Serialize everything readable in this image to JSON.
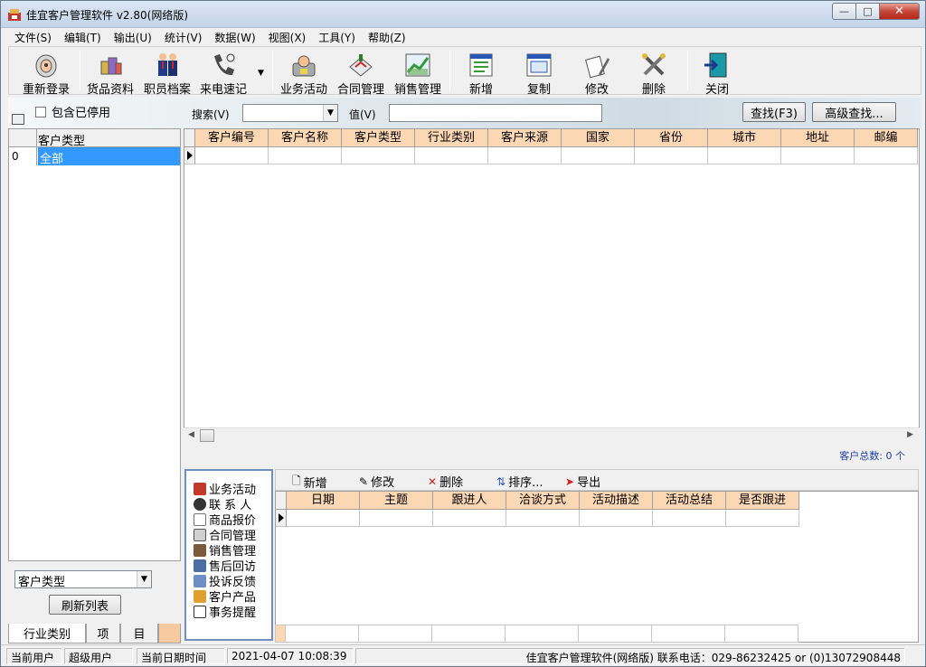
{
  "window": {
    "title": "佳宜客户管理软件 v2.80(网络版)"
  },
  "menu": [
    "文件(S)",
    "编辑(T)",
    "输出(U)",
    "统计(V)",
    "数据(W)",
    "视图(X)",
    "工具(Y)",
    "帮助(Z)"
  ],
  "toolbar": {
    "relogin": "重新登录",
    "goods": "货品资料",
    "staff": "职员档案",
    "calls": "来电速记",
    "activity": "业务活动",
    "contracts": "合同管理",
    "sales": "销售管理",
    "add": "新增",
    "copy": "复制",
    "edit": "修改",
    "delete": "删除",
    "close": "关闭"
  },
  "search": {
    "include_disabled": "包含已停用",
    "search_label": "搜索(V)",
    "value_label": "值(V)",
    "find_button": "查找(F3)",
    "advanced_button": "高级查找..."
  },
  "left": {
    "header": "客户类型",
    "rows": [
      {
        "index": "0",
        "label": "全部"
      }
    ],
    "filter_value": "客户类型",
    "refresh": "刷新列表",
    "tabs": [
      "行业类别",
      "项",
      "目"
    ]
  },
  "grid": {
    "columns": [
      "客户编号",
      "客户名称",
      "客户类型",
      "行业类别",
      "客户来源",
      "国家",
      "省份",
      "城市",
      "地址",
      "邮编"
    ]
  },
  "total_label": "客户总数: 0 个",
  "nav": [
    "业务活动",
    "联 系 人",
    "商品报价",
    "合同管理",
    "销售管理",
    "售后回访",
    "投诉反馈",
    "客户产品",
    "事务提醒"
  ],
  "subtoolbar": {
    "add": "新增",
    "edit": "修改",
    "delete": "删除",
    "sort": "排序...",
    "export": "导出"
  },
  "subgrid": {
    "columns": [
      "日期",
      "主题",
      "跟进人",
      "洽谈方式",
      "活动描述",
      "活动总结",
      "是否跟进"
    ]
  },
  "status": {
    "user_label": "当前用户",
    "user": "超级用户",
    "date_label": "当前日期时间",
    "datetime": "2021-04-07 10:08:39",
    "contact": "佳宜客户管理软件(网络版) 联系电话：029-86232425 or (0)13072908448"
  }
}
